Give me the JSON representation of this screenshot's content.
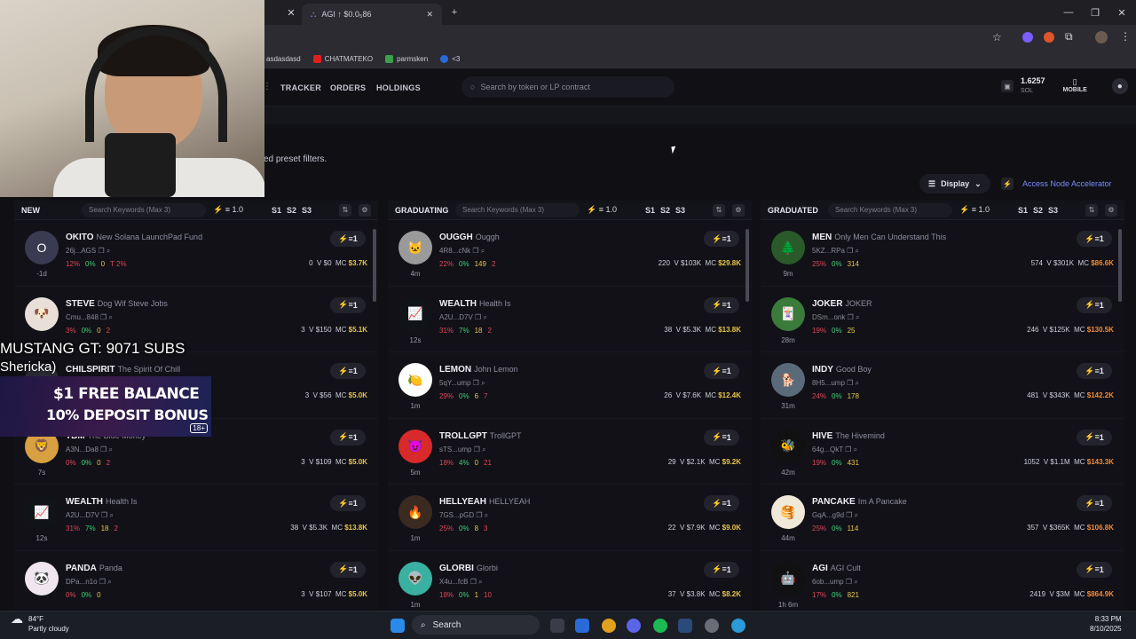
{
  "browser": {
    "tab_title": "AGI ↑ $0.0₅86",
    "new_tab": "+",
    "bookmarks": [
      "asdasdasd",
      "CHATMATEKO",
      "parmsken",
      "<3"
    ]
  },
  "nav": {
    "links": [
      "TRACKER",
      "ORDERS",
      "HOLDINGS"
    ],
    "search_placeholder": "Search by token or LP contract",
    "sol_balance": "1.6257",
    "sol_unit": "SOL",
    "mobile_label": "MOBILE"
  },
  "page": {
    "preset_text": "ed preset filters.",
    "display_label": "Display",
    "accelerator_label": "Access Node Accelerator"
  },
  "columns": [
    {
      "title": "NEW",
      "keyword_placeholder": "Search Keywords (Max 3)",
      "amount": "1.0",
      "presets": [
        "S1",
        "S2",
        "S3"
      ],
      "rows": [
        {
          "ticker": "OKITO",
          "name": "New Solana LaunchPad Fund",
          "addr": "26j...AGS",
          "age": "-1d",
          "s1": "12%",
          "s2": "0%",
          "s3": "0",
          "s4": "T 2%",
          "holders": "0",
          "vol": "$0",
          "mc": "$3.7K",
          "buy": "1",
          "avatar": "O",
          "avbg": "#3a3a52",
          "mccls": "yellow"
        },
        {
          "ticker": "STEVE",
          "name": "Dog Wif Steve Jobs",
          "addr": "Cmu...848",
          "age": "",
          "s1": "3%",
          "s2": "0%",
          "s3": "0",
          "s4": "2",
          "holders": "3",
          "vol": "$150",
          "mc": "$5.1K",
          "buy": "1",
          "avatar": "🐶",
          "avbg": "#e8e0d8",
          "mccls": "yellow"
        },
        {
          "ticker": "CHILSPIRIT",
          "name": "The Spirit Of Chill",
          "addr": "",
          "age": "",
          "s1": "",
          "s2": "",
          "s3": "",
          "s4": "",
          "holders": "3",
          "vol": "$56",
          "mc": "$5.0K",
          "buy": "1",
          "avatar": "",
          "avbg": "#2a2a34",
          "mccls": "yellow"
        },
        {
          "ticker": "TBM",
          "name": "The Blue Money",
          "addr": "A3N...Da8",
          "age": "7s",
          "s1": "0%",
          "s2": "0%",
          "s3": "0",
          "s4": "2",
          "holders": "3",
          "vol": "$109",
          "mc": "$5.0K",
          "buy": "1",
          "avatar": "🦁",
          "avbg": "#d8a040",
          "mccls": "yellow"
        },
        {
          "ticker": "WEALTH",
          "name": "Health Is",
          "addr": "A2U...D7V",
          "age": "12s",
          "s1": "31%",
          "s2": "7%",
          "s3": "18",
          "s4": "2",
          "holders": "38",
          "vol": "$5.3K",
          "mc": "$13.8K",
          "buy": "1",
          "avatar": "📈",
          "avbg": "#101418",
          "mccls": "yellow"
        },
        {
          "ticker": "PANDA",
          "name": "Panda",
          "addr": "DPa...n1o",
          "age": "",
          "s1": "0%",
          "s2": "0%",
          "s3": "0",
          "s4": "",
          "holders": "3",
          "vol": "$107",
          "mc": "$5.0K",
          "buy": "1",
          "avatar": "🐼",
          "avbg": "#f0e6f0",
          "mccls": "yellow"
        }
      ]
    },
    {
      "title": "GRADUATING",
      "keyword_placeholder": "Search Keywords (Max 3)",
      "amount": "1.0",
      "presets": [
        "S1",
        "S2",
        "S3"
      ],
      "rows": [
        {
          "ticker": "OUGGH",
          "name": "Ouggh",
          "addr": "4R8...cNk",
          "age": "4m",
          "s1": "22%",
          "s2": "0%",
          "s3": "149",
          "s4": "2",
          "holders": "220",
          "vol": "$103K",
          "mc": "$29.8K",
          "buy": "1",
          "avatar": "🐱",
          "avbg": "#9a9a9a",
          "mccls": "yellow"
        },
        {
          "ticker": "WEALTH",
          "name": "Health Is",
          "addr": "A2U...D7V",
          "age": "12s",
          "s1": "31%",
          "s2": "7%",
          "s3": "18",
          "s4": "2",
          "holders": "38",
          "vol": "$5.3K",
          "mc": "$13.8K",
          "buy": "1",
          "avatar": "📈",
          "avbg": "#101418",
          "mccls": "yellow"
        },
        {
          "ticker": "LEMON",
          "name": "John Lemon",
          "addr": "5qY...ump",
          "age": "1m",
          "s1": "29%",
          "s2": "0%",
          "s3": "6",
          "s4": "7",
          "holders": "26",
          "vol": "$7.6K",
          "mc": "$12.4K",
          "buy": "1",
          "avatar": "🍋",
          "avbg": "#ffffff",
          "mccls": "yellow"
        },
        {
          "ticker": "TROLLGPT",
          "name": "TrollGPT",
          "addr": "sTS...ump",
          "age": "5m",
          "s1": "18%",
          "s2": "4%",
          "s3": "0",
          "s4": "21",
          "holders": "29",
          "vol": "$2.1K",
          "mc": "$9.2K",
          "buy": "1",
          "avatar": "😈",
          "avbg": "#d82a2a",
          "mccls": "yellow"
        },
        {
          "ticker": "HELLYEAH",
          "name": "HELLYEAH",
          "addr": "7GS...pGD",
          "age": "1m",
          "s1": "25%",
          "s2": "0%",
          "s3": "8",
          "s4": "3",
          "holders": "22",
          "vol": "$7.9K",
          "mc": "$9.0K",
          "buy": "1",
          "avatar": "🔥",
          "avbg": "#3a2a20",
          "mccls": "yellow"
        },
        {
          "ticker": "GLORBI",
          "name": "Glorbi",
          "addr": "X4u...fcB",
          "age": "1m",
          "s1": "18%",
          "s2": "0%",
          "s3": "1",
          "s4": "10",
          "holders": "37",
          "vol": "$3.8K",
          "mc": "$8.2K",
          "buy": "1",
          "avatar": "👽",
          "avbg": "#3ab0a0",
          "mccls": "yellow"
        }
      ]
    },
    {
      "title": "GRADUATED",
      "keyword_placeholder": "Search Keywords (Max 3)",
      "amount": "1.0",
      "presets": [
        "S1",
        "S2",
        "S3"
      ],
      "rows": [
        {
          "ticker": "MEN",
          "name": "Only Men Can Understand This",
          "addr": "5KZ...RPa",
          "age": "9m",
          "s1": "25%",
          "s2": "0%",
          "s3": "314",
          "s4": "",
          "holders": "574",
          "vol": "$301K",
          "mc": "$86.6K",
          "buy": "1",
          "avatar": "🌲",
          "avbg": "#2a5a2a",
          "mccls": "orange"
        },
        {
          "ticker": "JOKER",
          "name": "JOKER",
          "addr": "DSm...onk",
          "age": "28m",
          "s1": "19%",
          "s2": "0%",
          "s3": "25",
          "s4": "",
          "holders": "246",
          "vol": "$125K",
          "mc": "$130.5K",
          "buy": "1",
          "avatar": "🃏",
          "avbg": "#3a7a3a",
          "mccls": "orange"
        },
        {
          "ticker": "INDY",
          "name": "Good Boy",
          "addr": "8H5...ump",
          "age": "31m",
          "s1": "24%",
          "s2": "0%",
          "s3": "178",
          "s4": "",
          "holders": "481",
          "vol": "$343K",
          "mc": "$142.2K",
          "buy": "1",
          "avatar": "🐕",
          "avbg": "#5a6a7a",
          "mccls": "orange"
        },
        {
          "ticker": "HIVE",
          "name": "The Hivemind",
          "addr": "64g...QkT",
          "age": "42m",
          "s1": "19%",
          "s2": "0%",
          "s3": "431",
          "s4": "",
          "holders": "1052",
          "vol": "$1.1M",
          "mc": "$143.3K",
          "buy": "1",
          "avatar": "🐝",
          "avbg": "#111111",
          "mccls": "orange"
        },
        {
          "ticker": "PANCAKE",
          "name": "Im A Pancake",
          "addr": "GqA...g9d",
          "age": "44m",
          "s1": "25%",
          "s2": "0%",
          "s3": "114",
          "s4": "",
          "holders": "357",
          "vol": "$365K",
          "mc": "$106.8K",
          "buy": "1",
          "avatar": "🥞",
          "avbg": "#f0e8d8",
          "mccls": "orange"
        },
        {
          "ticker": "AGI",
          "name": "AGI Cult",
          "addr": "6ob...ump",
          "age": "1h 6m",
          "s1": "17%",
          "s2": "0%",
          "s3": "821",
          "s4": "",
          "holders": "2419",
          "vol": "$3M",
          "mc": "$864.9K",
          "buy": "1",
          "avatar": "🤖",
          "avbg": "#111111",
          "mccls": "orange"
        }
      ]
    }
  ],
  "stream": {
    "overlay_line1": "MUSTANG GT: 9071 SUBS",
    "overlay_line2": "Shericka)",
    "promo_line1": "$1 FREE BALANCE",
    "promo_line2": "10% DEPOSIT BONUS",
    "promo_age": "18+"
  },
  "taskbar": {
    "temp": "84°F",
    "weather": "Partly cloudy",
    "search_label": "Search",
    "time": "8:33 PM",
    "date": "8/10/2025"
  }
}
